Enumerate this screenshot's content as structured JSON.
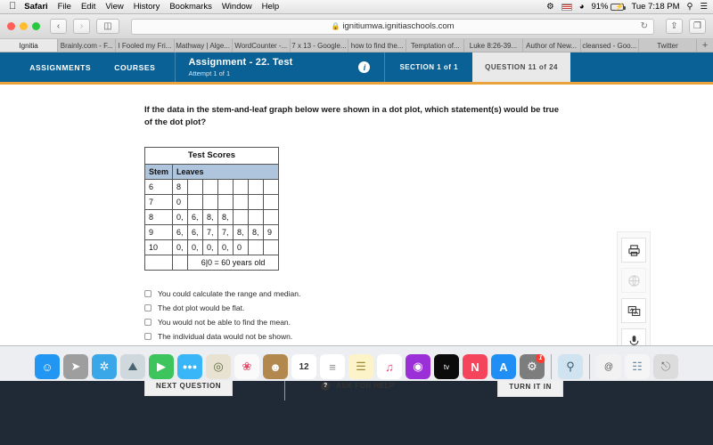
{
  "menubar": {
    "apple_icon": "apple-icon",
    "items": [
      {
        "label": "Safari",
        "bold": true
      },
      {
        "label": "File",
        "bold": false
      },
      {
        "label": "Edit",
        "bold": false
      },
      {
        "label": "View",
        "bold": false
      },
      {
        "label": "History",
        "bold": false
      },
      {
        "label": "Bookmarks",
        "bold": false
      },
      {
        "label": "Window",
        "bold": false
      },
      {
        "label": "Help",
        "bold": false
      }
    ],
    "status": {
      "battery_percent": "91%",
      "clock": "Tue 7:18 PM",
      "search_icon": "search-icon",
      "list_icon": "control-center-icon",
      "wifi_icon": "wifi-icon",
      "flag_icon": "us-flag-icon",
      "airplay_icon": "airplay-icon"
    }
  },
  "browser": {
    "back_icon": "back-chevron-icon",
    "forward_icon": "forward-chevron-icon",
    "sidebar_icon": "sidebar-icon",
    "url": "ignitiumwa.ignitiaschools.com",
    "lock_icon": "lock-icon",
    "reload_icon": "reload-icon",
    "share_icon": "share-icon",
    "tabs_overview_icon": "tab-overview-icon",
    "new_tab_label": "+",
    "tabs": [
      {
        "label": "Ignitia",
        "active": true
      },
      {
        "label": "Brainly.com - F...",
        "active": false
      },
      {
        "label": "I Fooled my Fri...",
        "active": false
      },
      {
        "label": "Mathway | Alge...",
        "active": false
      },
      {
        "label": "WordCounter -...",
        "active": false
      },
      {
        "label": "7 x 13 - Google...",
        "active": false
      },
      {
        "label": "how to find the...",
        "active": false
      },
      {
        "label": "Temptation of...",
        "active": false
      },
      {
        "label": "Luke 8:26-39...",
        "active": false
      },
      {
        "label": "Author of New...",
        "active": false
      },
      {
        "label": "cleansed - Goo...",
        "active": false
      },
      {
        "label": "Twitter",
        "active": false
      }
    ]
  },
  "app_header": {
    "assignments_label": "ASSIGNMENTS",
    "courses_label": "COURSES",
    "title": "Assignment  - 22. Test",
    "subtitle": "Attempt 1 of 1",
    "info_icon": "info-icon",
    "section_label": "SECTION 1 of 1",
    "question_label": "QUESTION 11 of 24",
    "accent_color": "#0a6196",
    "underline_color": "#e8a33d"
  },
  "question": {
    "text": "If the data in the stem-and-leaf graph below were shown in a dot plot, which statement(s) would be true of the dot plot?"
  },
  "stem_leaf": {
    "title": "Test Scores",
    "header": [
      "Stem",
      "Leaves"
    ],
    "header_bg": "#aec5dd",
    "rows": [
      {
        "stem": "6",
        "leaves": [
          "8",
          "",
          "",
          "",
          "",
          "",
          ""
        ]
      },
      {
        "stem": "7",
        "leaves": [
          "0",
          "",
          "",
          "",
          "",
          "",
          ""
        ]
      },
      {
        "stem": "8",
        "leaves": [
          "0,",
          "6,",
          "8,",
          "8,",
          "",
          "",
          ""
        ]
      },
      {
        "stem": "9",
        "leaves": [
          "6,",
          "6,",
          "7,",
          "7,",
          "8,",
          "8,",
          "9"
        ]
      },
      {
        "stem": "10",
        "leaves": [
          "0,",
          "0,",
          "0,",
          "0,",
          "0",
          "",
          ""
        ]
      }
    ],
    "legend": "6|0 = 60 years old"
  },
  "options": [
    {
      "label": "You could calculate the range and median.",
      "checked": false
    },
    {
      "label": "The dot plot would be flat.",
      "checked": false
    },
    {
      "label": "You would not be able to find the mean.",
      "checked": false
    },
    {
      "label": "The individual data would not be shown.",
      "checked": false
    }
  ],
  "actions": {
    "next_question": "NEXT QUESTION",
    "ask_for_help": "ASK FOR HELP",
    "help_icon": "question-mark-icon",
    "turn_it_in": "TURN IT IN"
  },
  "toolrail": [
    {
      "icon": "printer-icon",
      "glyph": "⎙",
      "disabled": false
    },
    {
      "icon": "globe-icon",
      "glyph": "◔",
      "disabled": true
    },
    {
      "icon": "translate-image-icon",
      "glyph": "❐",
      "disabled": false
    },
    {
      "icon": "microphone-icon",
      "glyph": "♁",
      "disabled": false
    }
  ],
  "dock": {
    "items": [
      {
        "name": "finder",
        "glyph": "☺",
        "bg": "#2196f3",
        "running": true
      },
      {
        "name": "launchpad",
        "glyph": "➤",
        "bg": "#9e9e9e",
        "running": false
      },
      {
        "name": "safari",
        "glyph": "✦",
        "bg": "#3aa7e8",
        "running": true
      },
      {
        "name": "photos-preview",
        "glyph": "⌂",
        "bg": "#cfd8dc",
        "running": false
      },
      {
        "name": "facetime",
        "glyph": "▶",
        "bg": "#3ec45c",
        "running": false
      },
      {
        "name": "messages",
        "glyph": "●●",
        "bg": "#38b6f8",
        "running": true
      },
      {
        "name": "maps",
        "glyph": "⌖",
        "bg": "#e8e2d2",
        "running": false
      },
      {
        "name": "photos",
        "glyph": "❀",
        "bg": "#fafafa",
        "running": false
      },
      {
        "name": "contacts",
        "glyph": "☻",
        "bg": "#b2884f",
        "running": false
      },
      {
        "name": "calendar",
        "glyph": "12",
        "bg": "#ffffff",
        "running": false
      },
      {
        "name": "reminders",
        "glyph": "≡",
        "bg": "#ffffff",
        "running": false
      },
      {
        "name": "notes",
        "glyph": "☰",
        "bg": "#fdf3c8",
        "running": false
      },
      {
        "name": "itunes",
        "glyph": "♫",
        "bg": "#ffffff",
        "running": false
      },
      {
        "name": "podcasts",
        "glyph": "◉",
        "bg": "#9b30d9",
        "running": false
      },
      {
        "name": "apple-tv",
        "glyph": "tv",
        "bg": "#0b0b0b",
        "running": false
      },
      {
        "name": "news",
        "glyph": "N",
        "bg": "#f5455c",
        "running": false
      },
      {
        "name": "app-store",
        "glyph": "A",
        "bg": "#1f8ff5",
        "running": false
      },
      {
        "name": "system-preferences",
        "glyph": "⚙",
        "bg": "#7d7d7d",
        "running": false,
        "badge": "1"
      }
    ],
    "right_items": [
      {
        "name": "preview",
        "glyph": "⌕",
        "bg": "#cfe3f0",
        "running": true
      },
      {
        "name": "mail-attachment",
        "glyph": "@",
        "bg": "#f2f2f2",
        "running": false
      },
      {
        "name": "document-stack",
        "glyph": "☷",
        "bg": "#f5f5f5",
        "running": false
      },
      {
        "name": "trash",
        "glyph": "⌫",
        "bg": "#dcdcdc",
        "running": false
      }
    ]
  }
}
